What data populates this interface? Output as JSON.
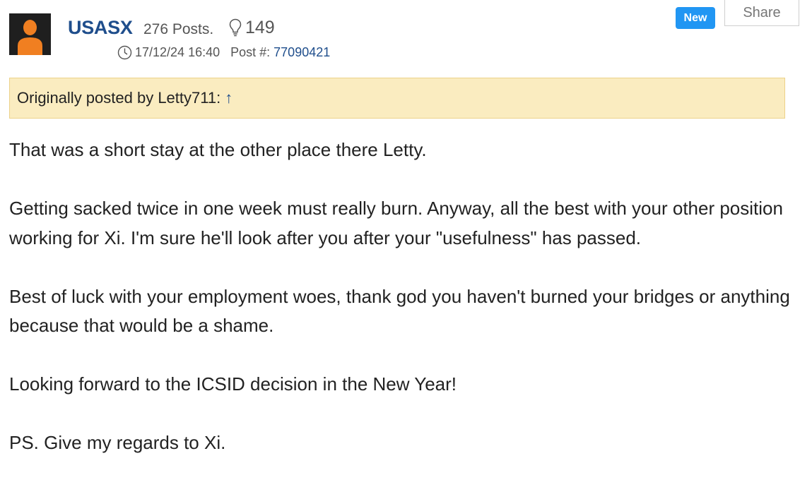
{
  "author": {
    "username": "USASX",
    "posts": "276 Posts.",
    "likes": "149"
  },
  "post": {
    "timestamp": "17/12/24 16:40",
    "post_number_label": "Post #:",
    "post_number": "77090421",
    "badge": "New",
    "share_label": "Share"
  },
  "quote": {
    "label": "Originally posted by Letty711:",
    "arrow": "↑"
  },
  "body": {
    "paragraphs": [
      "That was a short stay at the other place there Letty.",
      "Getting sacked twice in one week must really burn. Anyway, all the best with your other position working for Xi. I'm sure he'll look after you after your \"usefulness\" has passed.",
      "Best of luck with your employment woes, thank god you haven't burned your bridges or anything because that would be a shame.",
      "Looking forward to the ICSID decision in the New Year!",
      "PS. Give my regards to Xi."
    ]
  },
  "icons": {
    "avatar": "user-silhouette-icon",
    "likes": "lightbulb-icon",
    "time": "clock-icon"
  },
  "colors": {
    "username": "#1f4e8c",
    "badge_bg": "#2196f3",
    "quote_bg": "#faecc0",
    "quote_border": "#ecd28a",
    "avatar_person": "#f07f21",
    "avatar_bg": "#1f1f1f"
  }
}
